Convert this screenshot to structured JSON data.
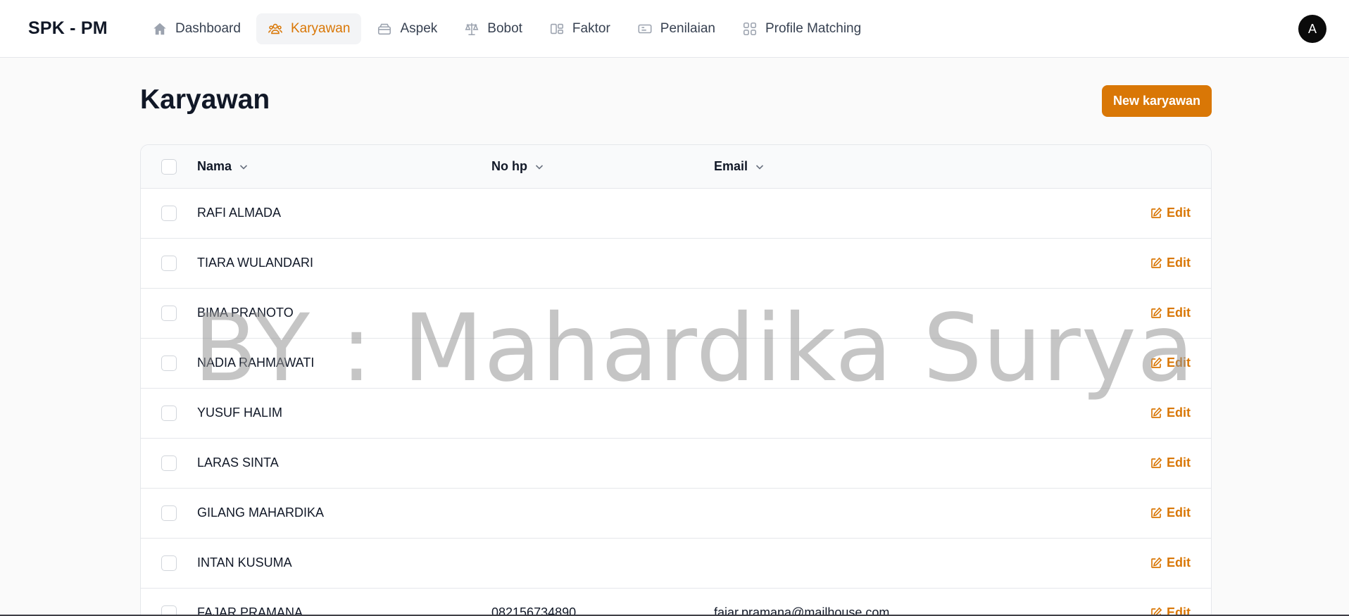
{
  "brand": "SPK - PM",
  "nav": [
    {
      "label": "Dashboard",
      "icon": "home-icon",
      "active": false
    },
    {
      "label": "Karyawan",
      "icon": "users-icon",
      "active": true
    },
    {
      "label": "Aspek",
      "icon": "layers-icon",
      "active": false
    },
    {
      "label": "Bobot",
      "icon": "scale-icon",
      "active": false
    },
    {
      "label": "Faktor",
      "icon": "blocks-icon",
      "active": false
    },
    {
      "label": "Penilaian",
      "icon": "ticket-icon",
      "active": false
    },
    {
      "label": "Profile Matching",
      "icon": "grid-icon",
      "active": false
    }
  ],
  "avatar": "A",
  "page": {
    "title": "Karyawan",
    "new_button": "New karyawan"
  },
  "table": {
    "columns": [
      "Nama",
      "No hp",
      "Email"
    ],
    "edit_label": "Edit",
    "rows": [
      {
        "nama": "RAFI ALMADA",
        "no_hp": "",
        "email": ""
      },
      {
        "nama": "TIARA WULANDARI",
        "no_hp": "",
        "email": ""
      },
      {
        "nama": "BIMA PRANOTO",
        "no_hp": "",
        "email": ""
      },
      {
        "nama": "NADIA RAHMAWATI",
        "no_hp": "",
        "email": ""
      },
      {
        "nama": "YUSUF HALIM",
        "no_hp": "",
        "email": ""
      },
      {
        "nama": "LARAS SINTA",
        "no_hp": "",
        "email": ""
      },
      {
        "nama": "GILANG MAHARDIKA",
        "no_hp": "",
        "email": ""
      },
      {
        "nama": "INTAN KUSUMA",
        "no_hp": "",
        "email": ""
      },
      {
        "nama": "FAJAR PRAMANA",
        "no_hp": "082156734890",
        "email": "fajar.pramana@mailhouse.com"
      }
    ]
  },
  "watermark": "BY : Mahardika Surya",
  "colors": {
    "accent": "#d97706",
    "text": "#111827",
    "border": "#e5e7eb"
  }
}
